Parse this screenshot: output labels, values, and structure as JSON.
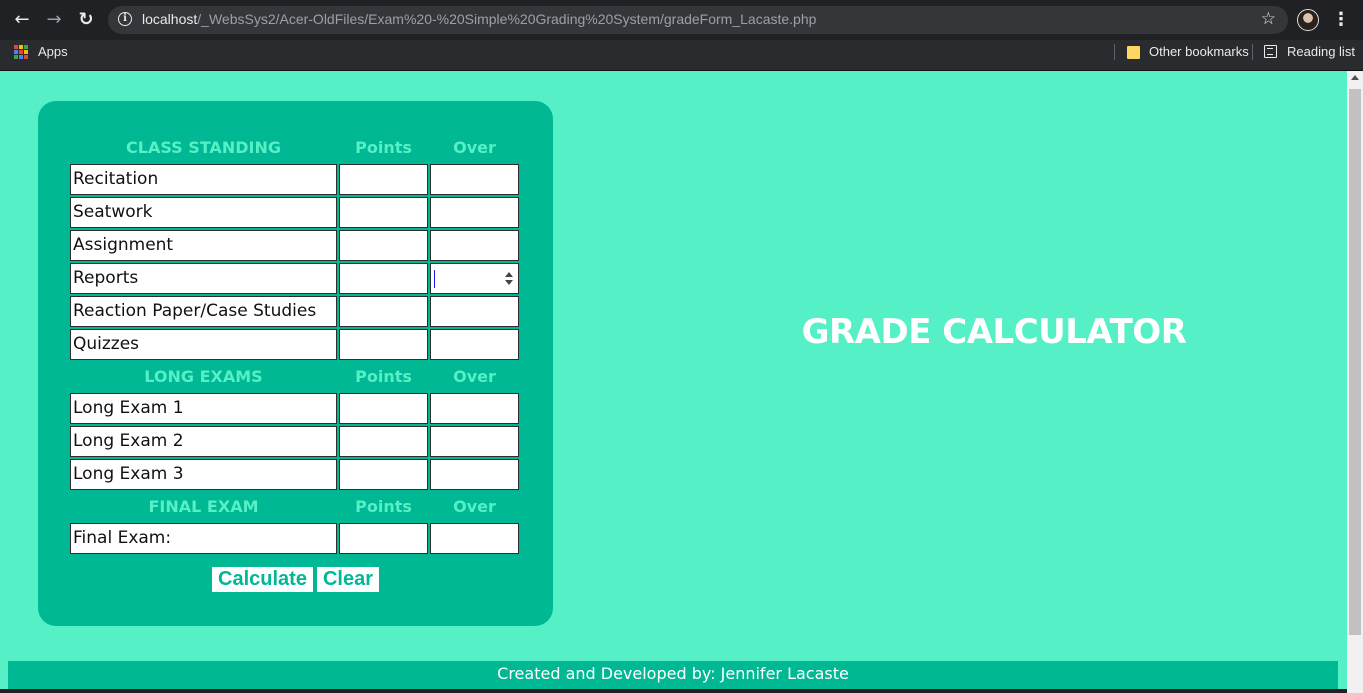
{
  "browser": {
    "url_host": "localhost",
    "url_path": "/_WebsSys2/Acer-OldFiles/Exam%20-%20Simple%20Grading%20System/gradeForm_Lacaste.php",
    "bookmarks": {
      "apps": "Apps",
      "other": "Other bookmarks",
      "reading_list": "Reading list"
    },
    "icons": [
      "back-arrow-icon",
      "forward-arrow-icon",
      "reload-icon",
      "info-icon",
      "star-icon",
      "profile-avatar",
      "kebab-menu-icon",
      "apps-grid-icon",
      "folder-icon",
      "reading-list-icon"
    ]
  },
  "form": {
    "class_standing": {
      "heading": "CLASS STANDING",
      "points_header": "Points",
      "over_header": "Over",
      "rows": [
        "Recitation",
        "Seatwork",
        "Assignment",
        "Reports",
        "Reaction Paper/Case Studies",
        "Quizzes"
      ]
    },
    "long_exams": {
      "heading": "LONG EXAMS",
      "points_header": "Points",
      "over_header": "Over",
      "rows": [
        "Long Exam 1",
        "Long Exam 2",
        "Long Exam 3"
      ]
    },
    "final_exam": {
      "heading": "FINAL EXAM",
      "points_header": "Points",
      "over_header": "Over",
      "rows": [
        "Final Exam:"
      ]
    },
    "buttons": {
      "calculate": "Calculate",
      "clear": "Clear"
    }
  },
  "title": "GRADE CALCULATOR",
  "footer": "Created and Developed by: Jennifer Lacaste",
  "colors": {
    "background": "#55f0c5",
    "card": "#00b894",
    "heading": "#55f0c5"
  }
}
